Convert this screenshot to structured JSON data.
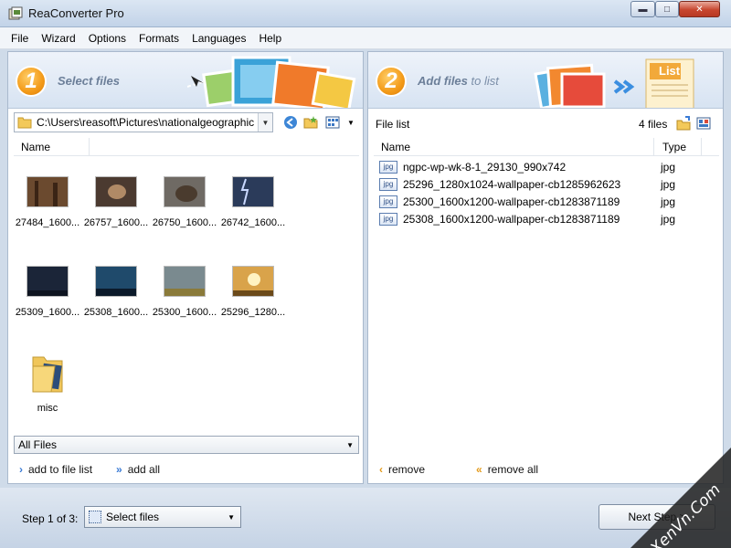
{
  "window": {
    "title": "ReaConverter Pro"
  },
  "menu": [
    "File",
    "Wizard",
    "Options",
    "Formats",
    "Languages",
    "Help"
  ],
  "left": {
    "step_number": "1",
    "step_title_bold": "Select files",
    "path": "C:\\Users\\reasoft\\Pictures\\nationalgeographic",
    "column_name": "Name",
    "thumbnails": [
      {
        "label": "27484_1600...",
        "color": "#6b4a2f"
      },
      {
        "label": "26757_1600...",
        "color": "#4b3a30"
      },
      {
        "label": "26750_1600...",
        "color": "#6f6a64"
      },
      {
        "label": "26742_1600...",
        "color": "#2b3b5a"
      },
      {
        "label": "25309_1600...",
        "color": "#1b2538"
      },
      {
        "label": "25308_1600...",
        "color": "#1f4a6b"
      },
      {
        "label": "25300_1600...",
        "color": "#7a8a8f"
      },
      {
        "label": "25296_1280...",
        "color": "#d9a34a"
      }
    ],
    "folder_label": "misc",
    "filter": "All Files",
    "add_to_list": "add to file list",
    "add_all": "add all"
  },
  "right": {
    "step_number": "2",
    "step_title_bold": "Add files",
    "step_title_rest": "to list",
    "list_badge_text": "List",
    "file_list_label": "File list",
    "files_count": "4 files",
    "columns": {
      "name": "Name",
      "type": "Type"
    },
    "icon_text": "jpg",
    "files": [
      {
        "name": "ngpc-wp-wk-8-1_29130_990x742",
        "type": "jpg"
      },
      {
        "name": "25296_1280x1024-wallpaper-cb1285962623",
        "type": "jpg"
      },
      {
        "name": "25300_1600x1200-wallpaper-cb1283871189",
        "type": "jpg"
      },
      {
        "name": "25308_1600x1200-wallpaper-cb1283871189",
        "type": "jpg"
      }
    ],
    "remove": "remove",
    "remove_all": "remove all"
  },
  "bottom": {
    "step_of": "Step 1 of 3:",
    "step_select": "Select files",
    "next_button": "Next Step >"
  },
  "watermark": "XenVn.Com"
}
